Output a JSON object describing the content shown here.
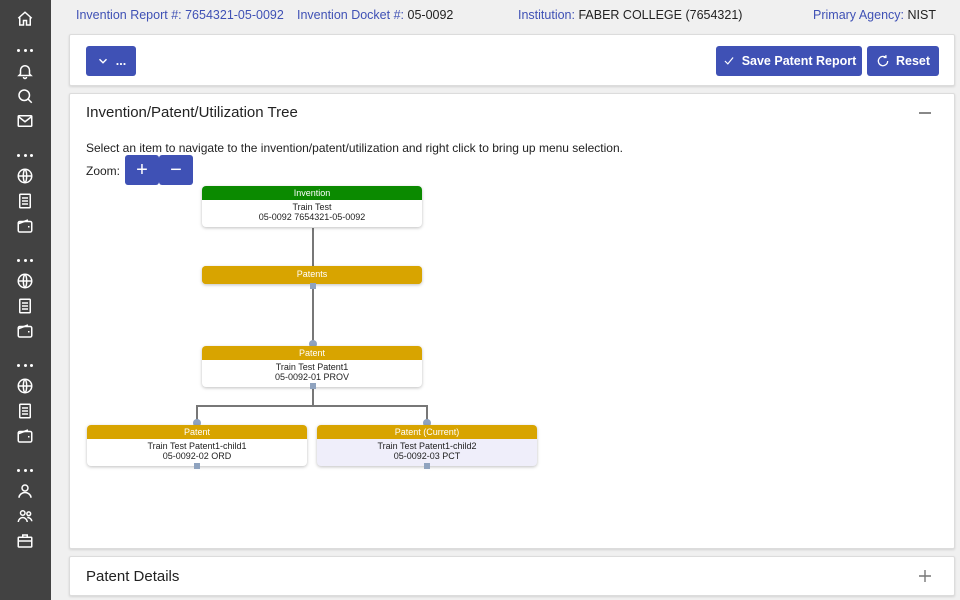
{
  "header": {
    "invention_report_label": "Invention Report #:",
    "invention_report_value": "7654321-05-0092",
    "invention_docket_label": "Invention Docket #:",
    "invention_docket_value": "05-0092",
    "institution_label": "Institution:",
    "institution_value": "FABER COLLEGE (7654321)",
    "agency_label": "Primary Agency:",
    "agency_value": "NIST"
  },
  "toolbar": {
    "more_label": "...",
    "save_label": "Save Patent Report",
    "reset_label": "Reset"
  },
  "tree_panel": {
    "title": "Invention/Patent/Utilization Tree",
    "instructions": "Select an item to navigate to the invention/patent/utilization and right click to bring up menu selection.",
    "zoom_label": "Zoom:",
    "zoom_in": "+",
    "zoom_out": "−"
  },
  "tree": {
    "invention": {
      "type": "Invention",
      "name": "Train Test",
      "code": "05-0092 7654321-05-0092"
    },
    "patents_group": {
      "type": "Patents"
    },
    "patent": {
      "type": "Patent",
      "name": "Train Test Patent1",
      "code": "05-0092-01 PROV"
    },
    "child1": {
      "type": "Patent",
      "name": "Train Test Patent1-child1",
      "code": "05-0092-02 ORD"
    },
    "child2": {
      "type": "Patent (Current)",
      "name": "Train Test Patent1-child2",
      "code": "05-0092-03 PCT"
    }
  },
  "details_panel": {
    "title": "Patent Details"
  },
  "colors": {
    "primary": "#3f51b5",
    "invention_header": "#0b8a00",
    "patent_header": "#d8a400",
    "sidebar": "#424242"
  },
  "sidebar_icons": [
    "home-icon",
    "bell-icon",
    "search-icon",
    "mail-icon",
    "globe-icon",
    "document-icon",
    "wallet-icon",
    "globe-icon",
    "document-icon",
    "wallet-icon",
    "globe-icon",
    "document-icon",
    "wallet-icon",
    "user-icon",
    "users-icon",
    "briefcase-icon"
  ]
}
